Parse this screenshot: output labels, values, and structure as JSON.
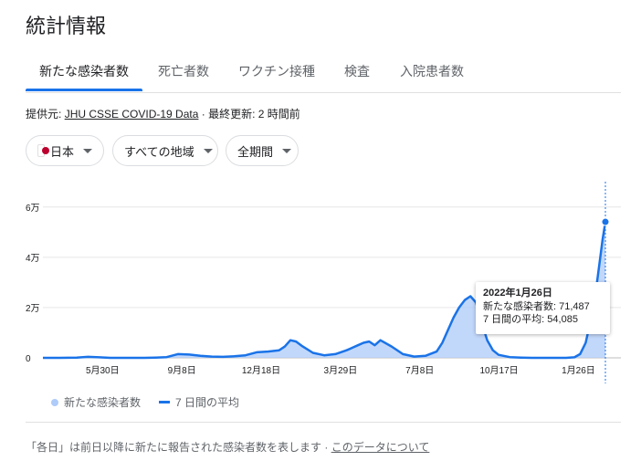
{
  "title": "統計情報",
  "tabs": [
    {
      "label": "新たな感染者数",
      "active": true
    },
    {
      "label": "死亡者数",
      "active": false
    },
    {
      "label": "ワクチン接種",
      "active": false
    },
    {
      "label": "検査",
      "active": false
    },
    {
      "label": "入院患者数",
      "active": false
    }
  ],
  "source": {
    "prefix": "提供元:",
    "link": "JHU CSSE COVID-19 Data",
    "updated": "· 最終更新: 2 時間前"
  },
  "filters": {
    "country": "日本",
    "region": "すべての地域",
    "period": "全期間"
  },
  "tooltip": {
    "date": "2022年1月26日",
    "new_cases": "新たな感染者数: 71,487",
    "avg": "7 日間の平均: 54,085"
  },
  "legend": {
    "new_cases": "新たな感染者数",
    "avg": "7 日間の平均"
  },
  "footnote": {
    "text": "「各日」は前日以降に新たに報告された感染者数を表します  ·",
    "link": "このデータについて"
  },
  "colors": {
    "accent": "#1a73e8",
    "area_fill": "#aecbfa",
    "flag_red": "#bc002d"
  },
  "chart_data": {
    "type": "area",
    "ytick_labels": [
      "0",
      "2万",
      "4万",
      "6万"
    ],
    "ytick_values": [
      0,
      20000,
      40000,
      60000
    ],
    "ylim": [
      0,
      65000
    ],
    "xtick_labels": [
      "5月30日",
      "9月8日",
      "12月18日",
      "3月29日",
      "7月8日",
      "10月17日",
      "1月26日"
    ],
    "xtick_values": [
      0.106,
      0.247,
      0.388,
      0.529,
      0.67,
      0.811,
      0.952
    ],
    "grid": true,
    "series": [
      {
        "name": "7 日間の平均",
        "x": [
          0.0,
          0.03,
          0.06,
          0.08,
          0.1,
          0.12,
          0.14,
          0.16,
          0.18,
          0.2,
          0.22,
          0.24,
          0.26,
          0.28,
          0.3,
          0.32,
          0.34,
          0.36,
          0.38,
          0.4,
          0.42,
          0.43,
          0.44,
          0.45,
          0.46,
          0.48,
          0.5,
          0.52,
          0.54,
          0.56,
          0.57,
          0.58,
          0.59,
          0.6,
          0.62,
          0.64,
          0.66,
          0.68,
          0.7,
          0.71,
          0.72,
          0.73,
          0.74,
          0.75,
          0.76,
          0.77,
          0.78,
          0.79,
          0.8,
          0.81,
          0.83,
          0.85,
          0.87,
          0.89,
          0.91,
          0.93,
          0.945,
          0.955,
          0.965,
          0.975,
          0.985,
          0.995,
          1.0
        ],
        "y": [
          0,
          0,
          100,
          400,
          200,
          0,
          0,
          0,
          0,
          100,
          300,
          1500,
          1300,
          800,
          500,
          400,
          600,
          1000,
          2200,
          2500,
          3000,
          4500,
          7000,
          6500,
          4800,
          2000,
          1000,
          1500,
          3000,
          5000,
          6000,
          6500,
          5000,
          7000,
          4500,
          1500,
          500,
          800,
          2500,
          6000,
          11000,
          16000,
          20000,
          23000,
          24500,
          22000,
          14000,
          7000,
          3000,
          1200,
          300,
          100,
          0,
          0,
          0,
          0,
          200,
          1500,
          6000,
          16000,
          30000,
          47000,
          54085
        ]
      }
    ]
  }
}
